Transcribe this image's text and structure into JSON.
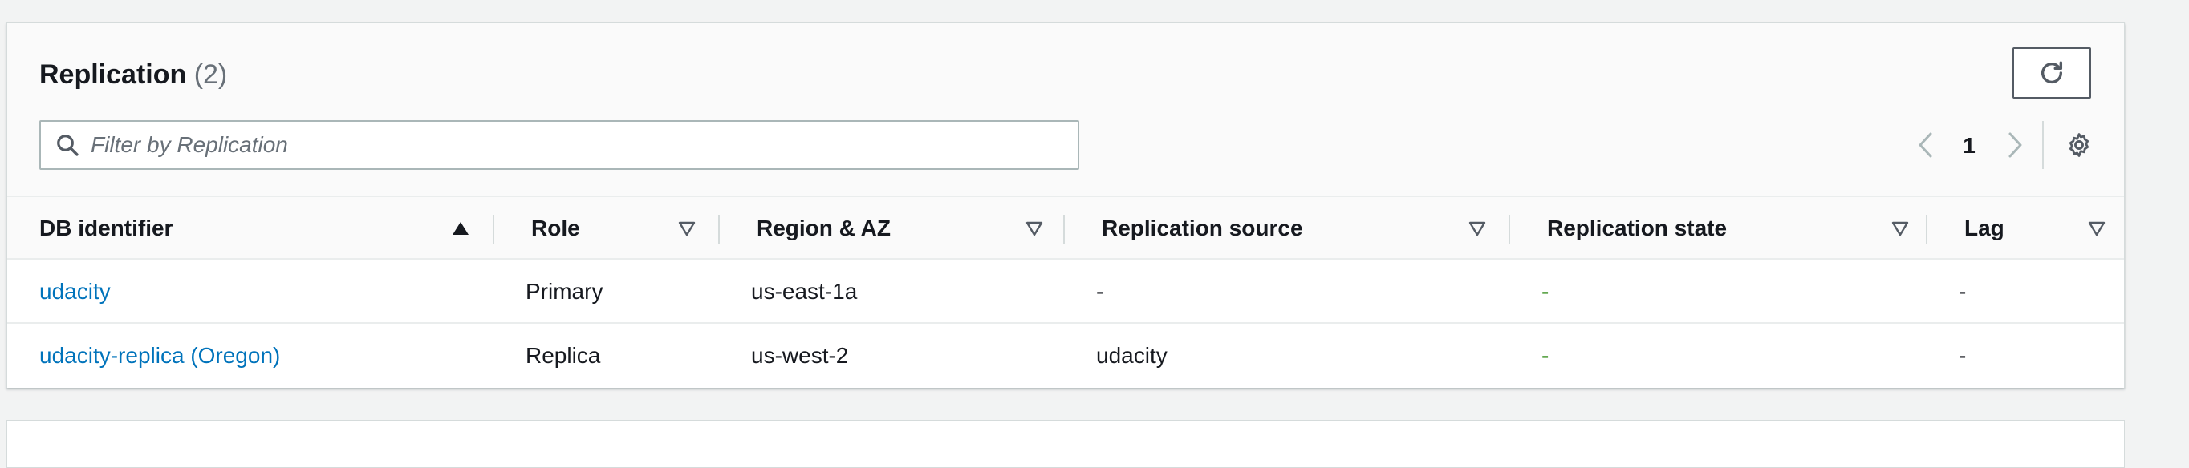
{
  "header": {
    "title": "Replication",
    "count": "(2)"
  },
  "search": {
    "placeholder": "Filter by Replication",
    "value": ""
  },
  "pagination": {
    "current_page": "1"
  },
  "columns": [
    {
      "label": "DB identifier",
      "sort": "ascending"
    },
    {
      "label": "Role",
      "sort": "none"
    },
    {
      "label": "Region & AZ",
      "sort": "none"
    },
    {
      "label": "Replication source",
      "sort": "none"
    },
    {
      "label": "Replication state",
      "sort": "none"
    },
    {
      "label": "Lag",
      "sort": "none"
    }
  ],
  "rows": [
    {
      "db_identifier": "udacity",
      "role": "Primary",
      "region": "us-east-1a",
      "source": "-",
      "state": "-",
      "lag": "-"
    },
    {
      "db_identifier": "udacity-replica (Oregon)",
      "role": "Replica",
      "region": "us-west-2",
      "source": "udacity",
      "state": "-",
      "lag": "-"
    }
  ],
  "icons": {
    "refresh": "refresh-icon",
    "search": "search-icon",
    "prev": "chevron-left-icon",
    "next": "chevron-right-icon",
    "settings": "gear-icon",
    "sort_asc": "caret-up-icon",
    "sort_none": "caret-down-outline-icon"
  },
  "colors": {
    "link": "#0073bb",
    "state_ok": "#1d8102",
    "text": "#16191f",
    "muted": "#687078"
  }
}
